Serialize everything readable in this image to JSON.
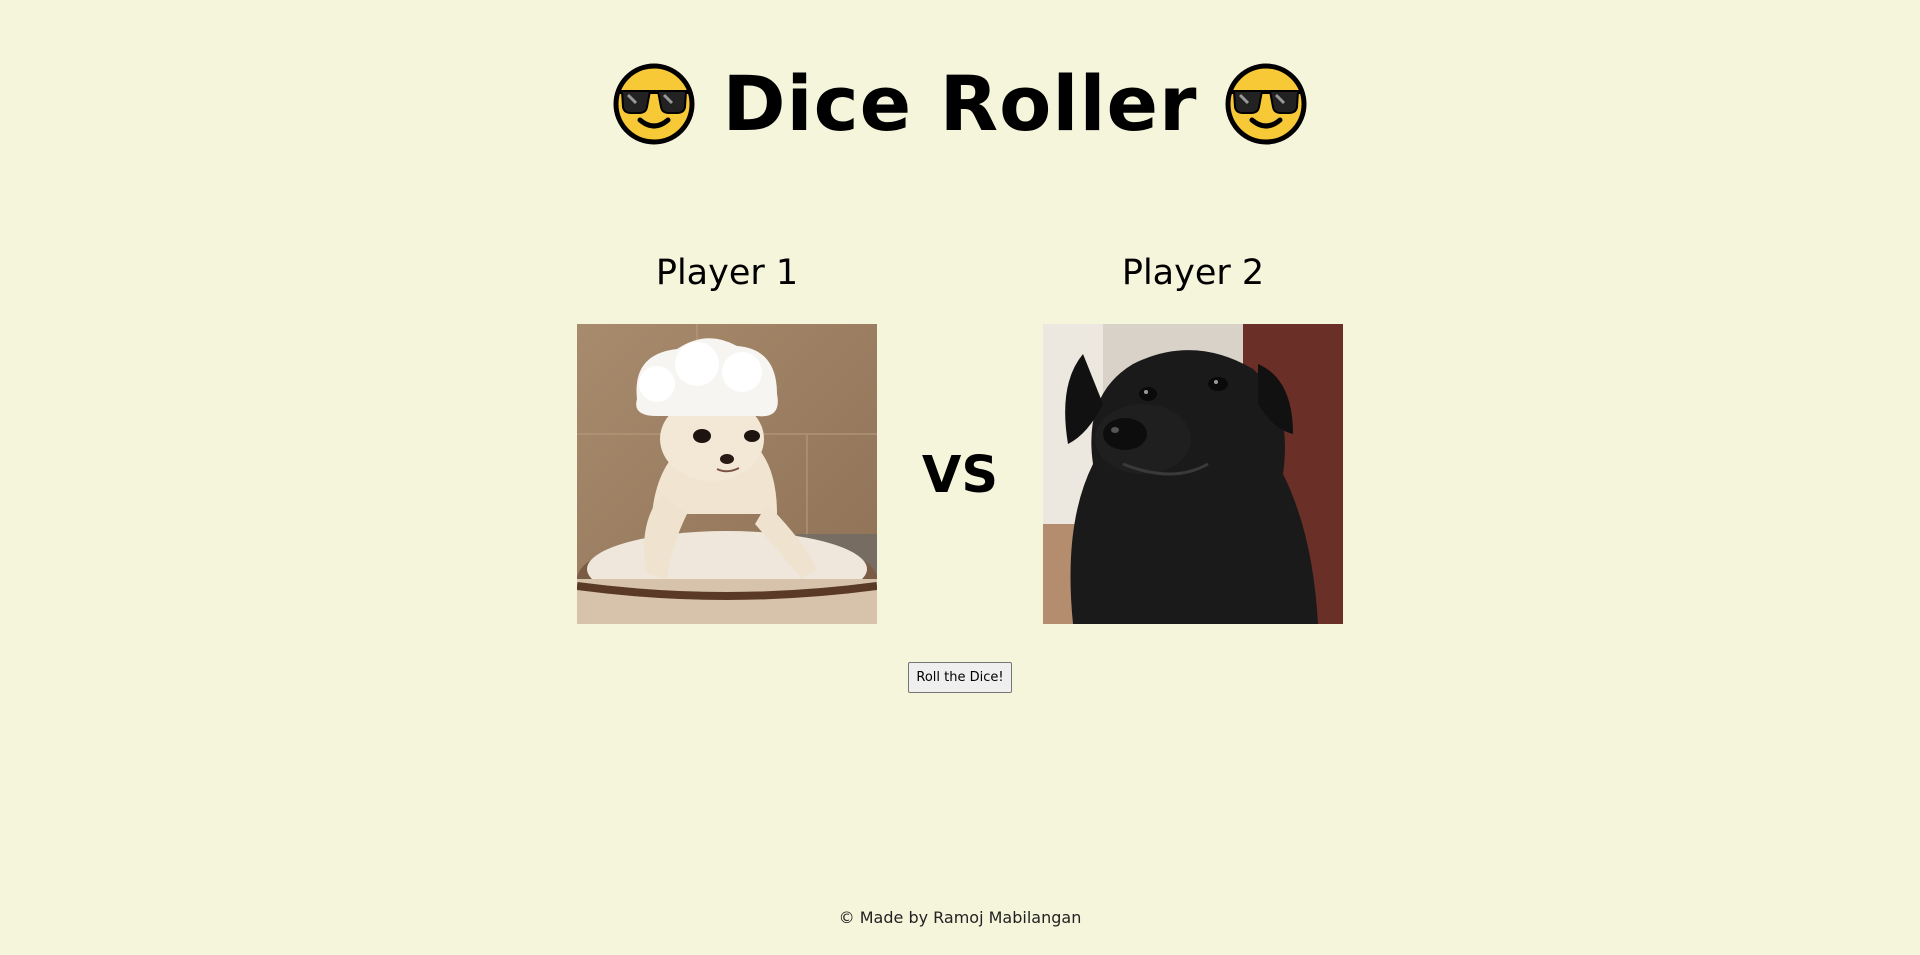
{
  "title": {
    "text": "Dice Roller",
    "left_icon": "smiling-face-with-sunglasses-icon",
    "right_icon": "smiling-face-with-sunglasses-icon"
  },
  "players": [
    {
      "label": "Player 1",
      "image": "chihuahua-with-towel-image"
    },
    {
      "label": "Player 2",
      "image": "black-dog-image"
    }
  ],
  "vs_text": "VS",
  "roll_button": {
    "label": "Roll the Dice!"
  },
  "footer": {
    "text": "© Made by Ramoj Mabilangan"
  },
  "colors": {
    "background": "#f5f5dc",
    "emoji_yellow": "#f8c936"
  }
}
